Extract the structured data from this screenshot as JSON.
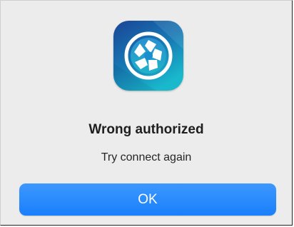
{
  "dialog": {
    "app_icon": "camera-aperture-icon",
    "title": "Wrong authorized",
    "message": "Try connect again",
    "ok_label": "OK"
  },
  "colors": {
    "background": "#ececec",
    "button": "#1a7ffb",
    "button_text": "#ffffff",
    "icon_gradient_top": "#1a4a9c",
    "icon_gradient_bottom": "#18b0c8"
  }
}
